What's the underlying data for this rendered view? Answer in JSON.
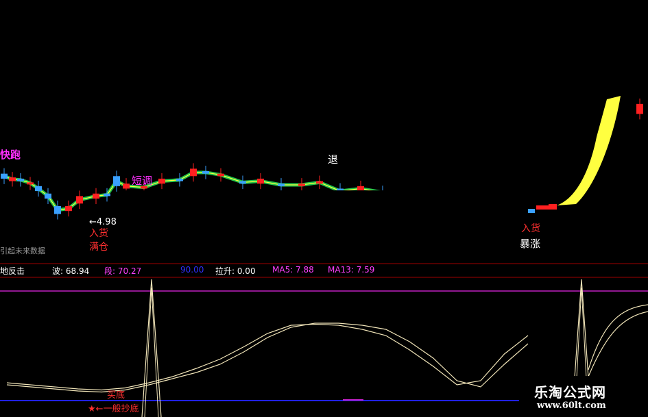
{
  "colors": {
    "up": "#ff2020",
    "down": "#3aa0ff",
    "neutral": "#ffffff",
    "ribbon_green": "#22c44a",
    "ribbon_yellow": "#ffff40",
    "signal_red": "#ff3030",
    "signal_magenta": "#ff30ff",
    "signal_white": "#ffffff",
    "osc_line": "#f0e4b8",
    "purple_line": "#c020c0",
    "blue_line": "#2020ff",
    "separator": "#a00000"
  },
  "main_panel": {
    "top_labels": [
      {
        "id": "kuaipao",
        "text": "快跑"
      },
      {
        "id": "tui",
        "text": "退"
      },
      {
        "id": "duantiao",
        "text": "短调"
      },
      {
        "id": "price_low",
        "text": "←4.98"
      },
      {
        "id": "rucang",
        "text": "入货"
      },
      {
        "id": "mancang",
        "text": "满仓"
      },
      {
        "id": "ruhuo2",
        "text": "入货"
      },
      {
        "id": "baozhang",
        "text": "暴涨"
      },
      {
        "id": "future",
        "text": "引起未来数据"
      }
    ]
  },
  "indicator_legend": {
    "name": "地反击",
    "items": [
      {
        "label": "波: 68.94",
        "color": "#ffffff"
      },
      {
        "label": "段: 70.27",
        "color": "#ff40ff"
      },
      {
        "label": "90.00",
        "color": "#3030ff"
      },
      {
        "label": "拉升: 0.00",
        "color": "#ffffff"
      },
      {
        "label": "MA5: 7.88",
        "color": "#ff40ff"
      },
      {
        "label": "MA13: 7.59",
        "color": "#ff40ff"
      }
    ]
  },
  "oscillator_labels": {
    "dingdi": "买底",
    "bottom": "★←一般抄底"
  },
  "watermark": {
    "title": "乐淘公式网",
    "url": "www.60lt.com"
  },
  "chart_data": {
    "type": "line",
    "candles_sample": [
      {
        "t": 0,
        "o": 6.6,
        "c": 6.4,
        "dir": "down"
      },
      {
        "t": 1,
        "o": 6.3,
        "c": 6.45,
        "dir": "up"
      },
      {
        "t": 2,
        "o": 6.4,
        "c": 6.3,
        "dir": "down"
      },
      {
        "t": 3,
        "o": 6.2,
        "c": 6.25,
        "dir": "up"
      },
      {
        "t": 4,
        "o": 6.1,
        "c": 5.9,
        "dir": "down"
      },
      {
        "t": 5,
        "o": 5.8,
        "c": 5.6,
        "dir": "down"
      },
      {
        "t": 6,
        "o": 5.3,
        "c": 4.98,
        "dir": "down"
      },
      {
        "t": 7,
        "o": 5.1,
        "c": 5.3,
        "dir": "up"
      },
      {
        "t": 8,
        "o": 5.4,
        "c": 5.7,
        "dir": "up"
      },
      {
        "t": 9,
        "o": 5.6,
        "c": 5.8,
        "dir": "up"
      },
      {
        "t": 10,
        "o": 5.8,
        "c": 5.7,
        "dir": "down"
      },
      {
        "t": 11,
        "o": 6.1,
        "c": 6.5,
        "dir": "down"
      },
      {
        "t": 12,
        "o": 6.0,
        "c": 6.2,
        "dir": "up"
      },
      {
        "t": 13,
        "o": 6.0,
        "c": 6.1,
        "dir": "up"
      },
      {
        "t": 14,
        "o": 6.2,
        "c": 6.4,
        "dir": "up"
      },
      {
        "t": 15,
        "o": 6.4,
        "c": 6.3,
        "dir": "down"
      },
      {
        "t": 16,
        "o": 6.5,
        "c": 6.8,
        "dir": "up"
      },
      {
        "t": 17,
        "o": 6.7,
        "c": 6.6,
        "dir": "down"
      },
      {
        "t": 18,
        "o": 6.5,
        "c": 6.6,
        "dir": "up"
      },
      {
        "t": 19,
        "o": 6.3,
        "c": 6.2,
        "dir": "down"
      },
      {
        "t": 20,
        "o": 6.2,
        "c": 6.4,
        "dir": "up"
      },
      {
        "t": 21,
        "o": 6.2,
        "c": 6.1,
        "dir": "down"
      },
      {
        "t": 22,
        "o": 6.1,
        "c": 6.2,
        "dir": "up"
      },
      {
        "t": 23,
        "o": 6.2,
        "c": 6.3,
        "dir": "up"
      },
      {
        "t": 24,
        "o": 6.0,
        "c": 5.8,
        "dir": "down"
      },
      {
        "t": 25,
        "o": 5.9,
        "c": 6.1,
        "dir": "up"
      },
      {
        "t": 26,
        "o": 5.9,
        "c": 5.8,
        "dir": "down"
      },
      {
        "t": 27,
        "o": 5.6,
        "c": 5.7,
        "dir": "up"
      },
      {
        "t": 28,
        "o": 5.5,
        "c": 5.4,
        "dir": "down"
      },
      {
        "t": 29,
        "o": 5.2,
        "c": 5.4,
        "dir": "up"
      },
      {
        "t": 30,
        "o": 5.4,
        "c": 5.3,
        "dir": "down"
      },
      {
        "t": 31,
        "o": 9.4,
        "c": 9.0,
        "dir": "up"
      }
    ],
    "oscillator_series": [
      {
        "name": "段",
        "values": [
          10,
          8,
          6,
          4,
          3,
          5,
          10,
          16,
          22,
          30,
          42,
          56,
          66,
          70,
          70,
          68,
          64,
          52,
          36,
          14,
          8,
          30,
          50
        ]
      },
      {
        "name": "波",
        "values": [
          12,
          10,
          8,
          6,
          5,
          7,
          12,
          18,
          26,
          35,
          47,
          60,
          68,
          69,
          68,
          64,
          58,
          44,
          28,
          10,
          14,
          40,
          58
        ]
      }
    ],
    "ylim": [
      0,
      100
    ]
  }
}
